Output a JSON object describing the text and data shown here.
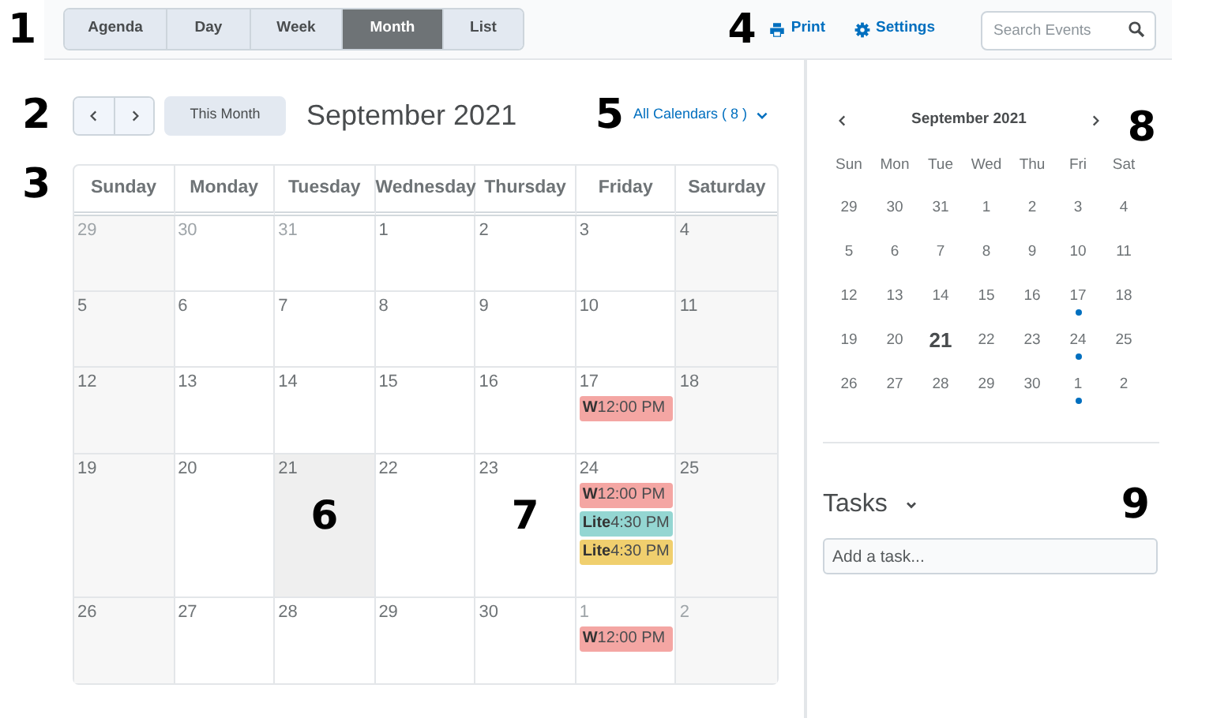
{
  "toolbar": {
    "callout": "1",
    "view_tabs": [
      {
        "label": "Agenda",
        "selected": false
      },
      {
        "label": "Day",
        "selected": false
      },
      {
        "label": "Week",
        "selected": false
      },
      {
        "label": "Month",
        "selected": true
      },
      {
        "label": "List",
        "selected": false
      }
    ],
    "actions_callout": "4",
    "actions": [
      {
        "kind": "print",
        "label": "Print"
      },
      {
        "kind": "settings",
        "label": "Settings"
      }
    ],
    "search": {
      "placeholder": "Search Events"
    }
  },
  "nav": {
    "callout": "2",
    "this_month": "This Month",
    "title": "September 2021",
    "filter_callout": "5",
    "filter": "All Calendars ( 8 )"
  },
  "month": {
    "callout": "3",
    "columns": [
      "Sunday",
      "Monday",
      "Tuesday",
      "Wednesday",
      "Thursday",
      "Friday",
      "Saturday"
    ],
    "weeks": [
      [
        {
          "day": "29",
          "in_month": false
        },
        {
          "day": "30",
          "in_month": false
        },
        {
          "day": "31",
          "in_month": false
        },
        {
          "day": "1",
          "in_month": true
        },
        {
          "day": "2",
          "in_month": true
        },
        {
          "day": "3",
          "in_month": true
        },
        {
          "day": "4",
          "in_month": true
        }
      ],
      [
        {
          "day": "5",
          "in_month": true
        },
        {
          "day": "6",
          "in_month": true
        },
        {
          "day": "7",
          "in_month": true
        },
        {
          "day": "8",
          "in_month": true
        },
        {
          "day": "9",
          "in_month": true
        },
        {
          "day": "10",
          "in_month": true
        },
        {
          "day": "11",
          "in_month": true
        }
      ],
      [
        {
          "day": "12",
          "in_month": true
        },
        {
          "day": "13",
          "in_month": true
        },
        {
          "day": "14",
          "in_month": true
        },
        {
          "day": "15",
          "in_month": true
        },
        {
          "day": "16",
          "in_month": true
        },
        {
          "day": "17",
          "in_month": true,
          "events": [
            {
              "title": "W",
              "time": "12:00 PM",
              "color": "#f4a6a3"
            }
          ]
        },
        {
          "day": "18",
          "in_month": true
        }
      ],
      [
        {
          "day": "19",
          "in_month": true
        },
        {
          "day": "20",
          "in_month": true
        },
        {
          "day": "21",
          "in_month": true,
          "today": true,
          "callout": "6"
        },
        {
          "day": "22",
          "in_month": true
        },
        {
          "day": "23",
          "in_month": true,
          "callout": "7"
        },
        {
          "day": "24",
          "in_month": true,
          "events": [
            {
              "title": "W",
              "time": "12:00 PM",
              "color": "#f4a6a3"
            },
            {
              "title": "Lite",
              "time": "4:30 PM",
              "color": "#94d6d2"
            },
            {
              "title": "Lite",
              "time": "4:30 PM",
              "color": "#f0cf6e"
            }
          ]
        },
        {
          "day": "25",
          "in_month": true
        }
      ],
      [
        {
          "day": "26",
          "in_month": true
        },
        {
          "day": "27",
          "in_month": true
        },
        {
          "day": "28",
          "in_month": true
        },
        {
          "day": "29",
          "in_month": true
        },
        {
          "day": "30",
          "in_month": true
        },
        {
          "day": "1",
          "in_month": false,
          "events": [
            {
              "title": "W",
              "time": "12:00 PM",
              "color": "#f4a6a3"
            }
          ]
        },
        {
          "day": "2",
          "in_month": false
        }
      ]
    ]
  },
  "mini_calendar": {
    "title": "September 2021",
    "callout": "8",
    "weekdays": [
      "Sun",
      "Mon",
      "Tue",
      "Wed",
      "Thu",
      "Fri",
      "Sat"
    ],
    "weeks": [
      [
        {
          "day": "29"
        },
        {
          "day": "30"
        },
        {
          "day": "31"
        },
        {
          "day": "1"
        },
        {
          "day": "2"
        },
        {
          "day": "3"
        },
        {
          "day": "4"
        }
      ],
      [
        {
          "day": "5"
        },
        {
          "day": "6"
        },
        {
          "day": "7"
        },
        {
          "day": "8"
        },
        {
          "day": "9"
        },
        {
          "day": "10"
        },
        {
          "day": "11"
        }
      ],
      [
        {
          "day": "12"
        },
        {
          "day": "13"
        },
        {
          "day": "14"
        },
        {
          "day": "15"
        },
        {
          "day": "16"
        },
        {
          "day": "17",
          "has_event": true
        },
        {
          "day": "18"
        }
      ],
      [
        {
          "day": "19"
        },
        {
          "day": "20"
        },
        {
          "day": "21",
          "today": true
        },
        {
          "day": "22"
        },
        {
          "day": "23"
        },
        {
          "day": "24",
          "has_event": true
        },
        {
          "day": "25"
        }
      ],
      [
        {
          "day": "26"
        },
        {
          "day": "27"
        },
        {
          "day": "28"
        },
        {
          "day": "29"
        },
        {
          "day": "30"
        },
        {
          "day": "1",
          "has_event": true
        },
        {
          "day": "2"
        }
      ]
    ]
  },
  "tasks": {
    "title": "Tasks",
    "callout": "9",
    "placeholder": "Add a task..."
  }
}
